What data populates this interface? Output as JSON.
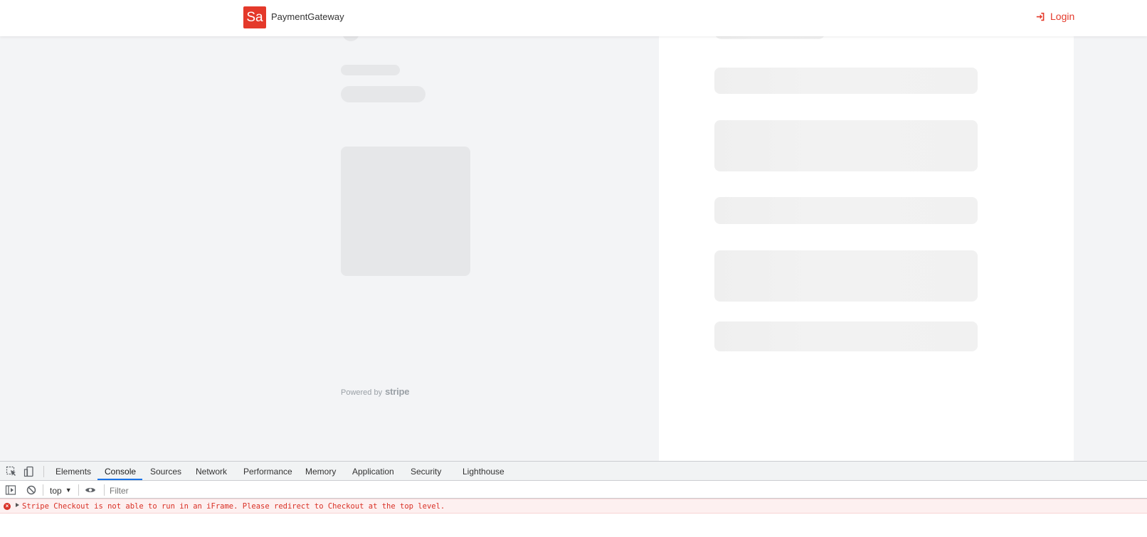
{
  "header": {
    "logo_text": "Sa",
    "brand_name": "PaymentGateway",
    "login_label": "Login",
    "login_icon": "sign-in-icon",
    "accent_color": "#e4392a"
  },
  "checkout": {
    "state": "loading-skeleton",
    "powered_by_label": "Powered by",
    "powered_by_brand": "stripe"
  },
  "devtools": {
    "tools": [
      {
        "name": "inspect-element-icon"
      },
      {
        "name": "device-toolbar-icon"
      }
    ],
    "tabs": [
      {
        "label": "Elements",
        "active": false
      },
      {
        "label": "Console",
        "active": true
      },
      {
        "label": "Sources",
        "active": false
      },
      {
        "label": "Network",
        "active": false
      },
      {
        "label": "Performance",
        "active": false
      },
      {
        "label": "Memory",
        "active": false
      },
      {
        "label": "Application",
        "active": false
      },
      {
        "label": "Security",
        "active": false
      },
      {
        "label": "Lighthouse",
        "active": false
      }
    ],
    "console": {
      "context_label": "top",
      "filter_placeholder": "Filter",
      "messages": [
        {
          "level": "error",
          "text": "Stripe Checkout is not able to run in an iFrame. Please redirect to Checkout at the top level."
        }
      ]
    }
  }
}
